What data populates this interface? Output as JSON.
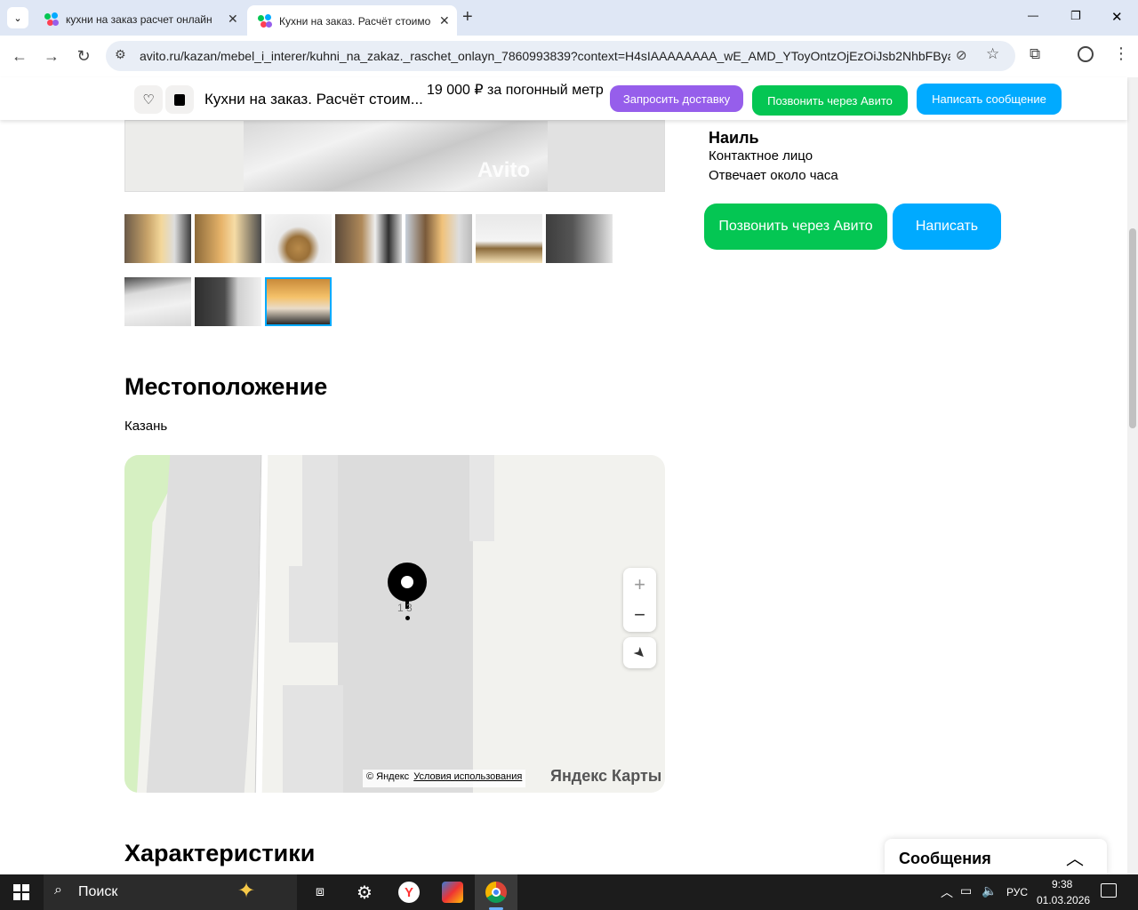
{
  "browser": {
    "tabs": [
      {
        "title": "кухни на заказ расчет онлайн",
        "active": false
      },
      {
        "title": "Кухни на заказ. Расчёт стоимо",
        "active": true
      }
    ],
    "new_tab": "+",
    "url": "avito.ru/kazan/mebel_i_interer/kuhni_na_zakaz._raschet_onlayn_7860993839?context=H4sIAAAAAAAA_wE_AMD_YToyOntzOjEzOiJsb2NhbFByaW9...",
    "window_controls": {
      "minimize": "—",
      "restore": "❐",
      "close": "✕"
    }
  },
  "sticky_bar": {
    "title": "Кухни на заказ. Расчёт стоим...",
    "price": "19 000 ₽ за погонный метр",
    "delivery_button": "Запросить доставку",
    "call_button": "Позвонить через Авито",
    "message_button": "Написать сообщение"
  },
  "gallery": {
    "watermark": "Avito",
    "thumbnail_count": 10,
    "selected_index": 9
  },
  "seller": {
    "name": "Наиль",
    "type": "Контактное лицо",
    "response": "Отвечает около часа",
    "call_button": "Позвонить через Авито",
    "write_button": "Написать"
  },
  "location": {
    "heading": "Местоположение",
    "city": "Казань",
    "house_label": "1 3",
    "zoom_in": "+",
    "zoom_out": "−",
    "copyright": "© Яндекс",
    "terms": "Условия использования",
    "brand": "Яндекс Карты"
  },
  "characteristics": {
    "heading": "Характеристики"
  },
  "messages_widget": {
    "label": "Сообщения"
  },
  "taskbar": {
    "search": "Поиск",
    "language": "РУС",
    "time": "9:38",
    "date": "01.03.2026"
  },
  "colors": {
    "green": "#04c653",
    "blue": "#00aaff",
    "purple": "#965eeb",
    "tab_bar": "#dfe7f5"
  }
}
